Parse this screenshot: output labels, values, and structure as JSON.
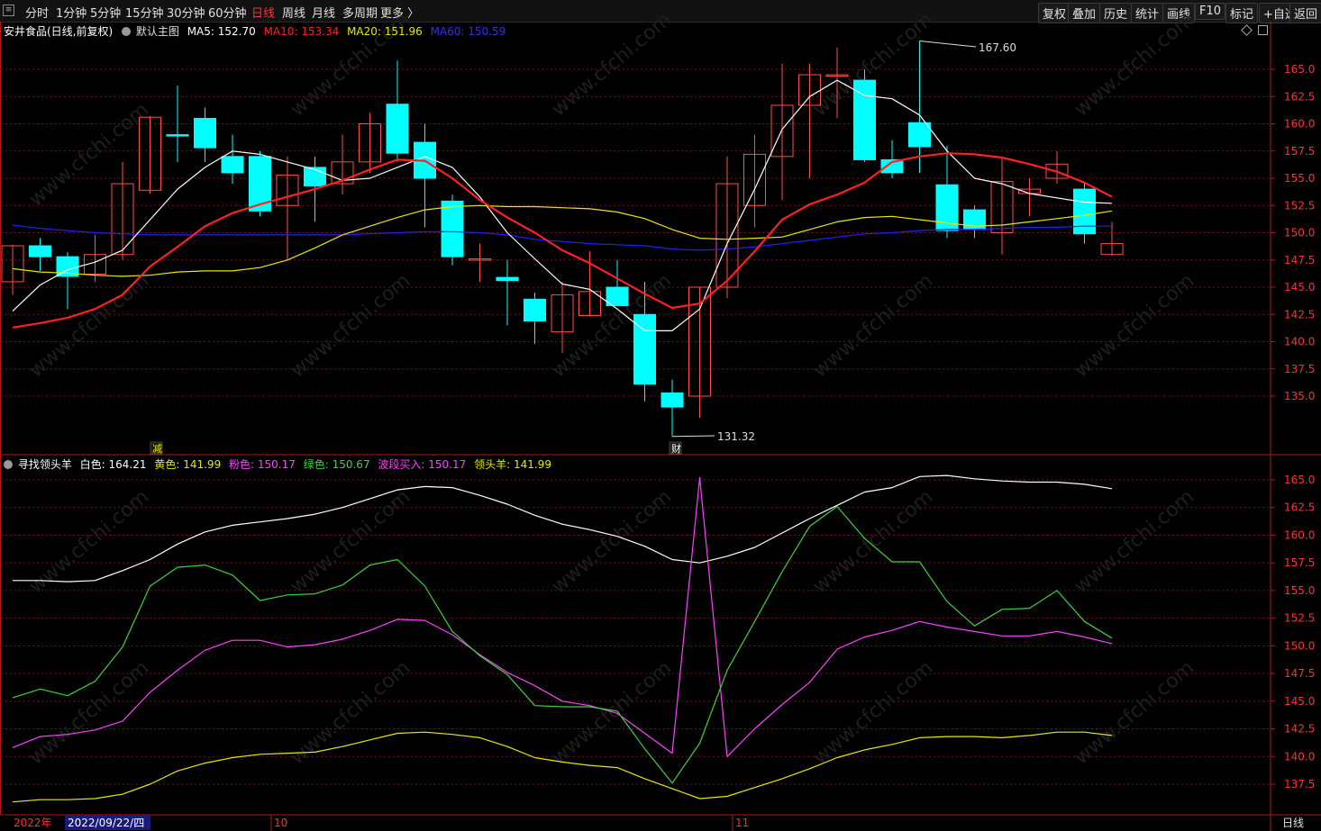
{
  "toolbar": {
    "periods": [
      "分时",
      "1分钟",
      "5分钟",
      "15分钟",
      "30分钟",
      "60分钟",
      "日线",
      "周线",
      "月线",
      "多周期",
      "更多 〉"
    ],
    "active_period": "日线",
    "right_buttons": [
      "复权",
      "叠加",
      "历史",
      "统计",
      "画线",
      "F10",
      "标记",
      "+自选",
      "返回"
    ]
  },
  "main_header": {
    "title": "安井食品(日线,前复权)",
    "template": "默认主图",
    "ma5": "MA5: 152.70",
    "ma10": "MA10: 153.34",
    "ma20": "MA20: 151.96",
    "ma60": "MA60: 150.59"
  },
  "sub_header": {
    "name": "寻找领头羊",
    "white": "白色: 164.21",
    "yellow": "黄色: 141.99",
    "pink": "粉色: 150.17",
    "green": "绿色: 150.67",
    "wave": "波段买入: 150.17",
    "leader": "领头羊: 141.99"
  },
  "annotations": {
    "high_label": "167.60",
    "low_label": "131.32",
    "marker1": "减",
    "marker2": "财"
  },
  "bottom_axis": {
    "year": "2022年",
    "cursor_date": "2022/09/22/四",
    "months": [
      "10",
      "11"
    ],
    "period": "日线"
  },
  "watermark": "www.cfchi.com",
  "colors": {
    "up": "#ff4d4d",
    "down": "#00ffff",
    "ma5": "#ffffff",
    "ma10": "#ff2020",
    "ma20": "#e8e800",
    "ma60": "#2020ff",
    "white": "#ffffff",
    "yellow": "#e8e800",
    "pink": "#ff40ff",
    "green": "#40d040"
  },
  "chart_data": [
    {
      "type": "candlestick",
      "title": "安井食品(日线,前复权)",
      "ylim": [
        131,
        167.6
      ],
      "yticks": [
        135.0,
        137.5,
        140.0,
        142.5,
        145.0,
        147.5,
        150.0,
        152.5,
        155.0,
        157.5,
        160.0,
        162.5,
        165.0
      ],
      "candles": [
        {
          "o": 145.5,
          "h": 148.9,
          "l": 144.3,
          "c": 148.8
        },
        {
          "o": 148.8,
          "h": 149.5,
          "l": 146.5,
          "c": 147.8
        },
        {
          "o": 147.8,
          "h": 148.2,
          "l": 143.0,
          "c": 146.0
        },
        {
          "o": 146.2,
          "h": 149.8,
          "l": 145.5,
          "c": 148.0
        },
        {
          "o": 148.0,
          "h": 156.5,
          "l": 147.5,
          "c": 154.5
        },
        {
          "o": 153.9,
          "h": 160.7,
          "l": 153.6,
          "c": 160.6
        },
        {
          "o": 159.0,
          "h": 163.5,
          "l": 156.5,
          "c": 158.9
        },
        {
          "o": 160.5,
          "h": 161.5,
          "l": 156.5,
          "c": 157.8
        },
        {
          "o": 157.0,
          "h": 159.0,
          "l": 154.5,
          "c": 155.5
        },
        {
          "o": 157.0,
          "h": 157.5,
          "l": 151.5,
          "c": 152.0
        },
        {
          "o": 152.5,
          "h": 157.0,
          "l": 147.5,
          "c": 155.3
        },
        {
          "o": 156.0,
          "h": 157.0,
          "l": 151.0,
          "c": 154.3
        },
        {
          "o": 154.5,
          "h": 159.0,
          "l": 153.5,
          "c": 156.5
        },
        {
          "o": 156.5,
          "h": 161.0,
          "l": 155.5,
          "c": 160.0
        },
        {
          "o": 161.8,
          "h": 165.8,
          "l": 156.5,
          "c": 157.3
        },
        {
          "o": 158.3,
          "h": 160.0,
          "l": 150.5,
          "c": 155.0
        },
        {
          "o": 152.9,
          "h": 153.5,
          "l": 147.0,
          "c": 147.8
        },
        {
          "o": 147.6,
          "h": 149.0,
          "l": 145.5,
          "c": 147.6
        },
        {
          "o": 145.9,
          "h": 147.5,
          "l": 141.5,
          "c": 145.6
        },
        {
          "o": 143.9,
          "h": 144.5,
          "l": 139.8,
          "c": 141.9
        },
        {
          "o": 140.9,
          "h": 145.5,
          "l": 139.0,
          "c": 144.3
        },
        {
          "o": 142.4,
          "h": 148.3,
          "l": 142.3,
          "c": 144.6
        },
        {
          "o": 145.0,
          "h": 147.5,
          "l": 143.5,
          "c": 143.3
        },
        {
          "o": 142.5,
          "h": 145.5,
          "l": 134.5,
          "c": 136.1
        },
        {
          "o": 135.3,
          "h": 136.5,
          "l": 131.3,
          "c": 134.0
        },
        {
          "o": 135.0,
          "h": 145.0,
          "l": 133.0,
          "c": 145.0
        },
        {
          "o": 145.0,
          "h": 157.0,
          "l": 144.0,
          "c": 154.5
        },
        {
          "o": 152.5,
          "h": 159.0,
          "l": 150.5,
          "c": 157.2
        },
        {
          "o": 157.0,
          "h": 165.5,
          "l": 153.0,
          "c": 161.7
        },
        {
          "o": 161.7,
          "h": 165.5,
          "l": 155.0,
          "c": 164.5
        },
        {
          "o": 164.5,
          "h": 167.0,
          "l": 160.5,
          "c": 164.5
        },
        {
          "o": 164.0,
          "h": 165.0,
          "l": 156.5,
          "c": 156.7
        },
        {
          "o": 156.7,
          "h": 158.5,
          "l": 155.0,
          "c": 155.5
        },
        {
          "o": 160.1,
          "h": 167.6,
          "l": 155.5,
          "c": 157.9
        },
        {
          "o": 154.4,
          "h": 158.0,
          "l": 149.5,
          "c": 150.2
        },
        {
          "o": 152.1,
          "h": 152.5,
          "l": 149.5,
          "c": 150.3
        },
        {
          "o": 150.0,
          "h": 157.0,
          "l": 148.0,
          "c": 154.7
        },
        {
          "o": 153.6,
          "h": 155.0,
          "l": 151.5,
          "c": 154.0
        },
        {
          "o": 155.0,
          "h": 157.5,
          "l": 154.5,
          "c": 156.3
        },
        {
          "o": 154.0,
          "h": 154.5,
          "l": 149.0,
          "c": 149.9
        },
        {
          "o": 148.0,
          "h": 151.0,
          "l": 147.9,
          "c": 149.0
        }
      ],
      "ma5": [
        142.8,
        145.2,
        146.6,
        147.3,
        148.4,
        151.2,
        154.0,
        156.0,
        157.5,
        157.2,
        156.5,
        155.8,
        154.8,
        155.0,
        156.0,
        157.0,
        156.0,
        153.3,
        150.0,
        147.6,
        145.3,
        144.8,
        143.0,
        141.0,
        141.0,
        143.0,
        149.0,
        154.0,
        159.5,
        162.5,
        164.0,
        162.6,
        162.3,
        160.8,
        157.5,
        155.0,
        154.5,
        153.6,
        153.2,
        152.8,
        152.7
      ],
      "ma10": [
        141.3,
        141.7,
        142.2,
        143.0,
        144.3,
        146.9,
        148.7,
        150.6,
        151.8,
        152.6,
        153.3,
        154.0,
        154.8,
        155.8,
        156.7,
        156.6,
        155.0,
        153.0,
        151.4,
        150.0,
        148.4,
        147.2,
        145.8,
        144.4,
        143.1,
        143.5,
        145.6,
        148.3,
        151.2,
        152.6,
        153.5,
        154.6,
        156.5,
        157.0,
        157.3,
        157.2,
        156.9,
        156.3,
        155.6,
        154.6,
        153.3
      ],
      "ma20": [
        146.7,
        146.4,
        146.3,
        146.1,
        146.0,
        146.1,
        146.4,
        146.5,
        146.5,
        146.8,
        147.5,
        148.6,
        149.8,
        150.6,
        151.4,
        152.1,
        152.4,
        152.5,
        152.4,
        152.4,
        152.3,
        152.2,
        151.9,
        151.3,
        150.3,
        149.5,
        149.4,
        149.5,
        149.6,
        150.3,
        151.0,
        151.4,
        151.5,
        151.2,
        150.9,
        150.6,
        150.7,
        151.0,
        151.3,
        151.6,
        152.0
      ],
      "ma60": [
        150.7,
        150.4,
        150.2,
        150.0,
        149.9,
        149.8,
        149.8,
        149.8,
        149.8,
        149.8,
        149.8,
        149.8,
        149.8,
        149.9,
        150.0,
        150.1,
        150.1,
        150.0,
        149.8,
        149.4,
        149.2,
        149.0,
        148.9,
        148.8,
        148.5,
        148.4,
        148.5,
        148.7,
        149.0,
        149.3,
        149.6,
        149.9,
        150.0,
        150.2,
        150.3,
        150.3,
        150.4,
        150.5,
        150.5,
        150.6,
        150.6
      ]
    },
    {
      "type": "line",
      "title": "寻找领头羊",
      "ylim": [
        135.8,
        166.7
      ],
      "yticks": [
        137.5,
        140.0,
        142.5,
        145.0,
        147.5,
        150.0,
        152.5,
        155.0,
        157.5,
        160.0,
        162.5,
        165.0
      ],
      "series": [
        {
          "name": "白色",
          "values": [
            155.9,
            155.9,
            155.8,
            155.9,
            156.8,
            157.8,
            159.2,
            160.3,
            160.9,
            161.2,
            161.5,
            161.9,
            162.5,
            163.3,
            164.1,
            164.4,
            164.3,
            163.6,
            162.8,
            161.8,
            161.0,
            160.5,
            159.9,
            159.0,
            157.8,
            157.5,
            158.1,
            158.9,
            160.2,
            161.5,
            162.7,
            163.9,
            164.3,
            165.3,
            165.4,
            165.1,
            164.9,
            164.8,
            164.8,
            164.6,
            164.2
          ]
        },
        {
          "name": "黄色",
          "values": [
            135.9,
            136.1,
            136.1,
            136.2,
            136.6,
            137.5,
            138.7,
            139.4,
            139.9,
            140.2,
            140.3,
            140.4,
            140.9,
            141.5,
            142.1,
            142.2,
            142.0,
            141.7,
            140.9,
            139.9,
            139.5,
            139.2,
            139.0,
            138.0,
            137.1,
            136.2,
            136.4,
            137.2,
            138.0,
            138.9,
            139.9,
            140.6,
            141.1,
            141.7,
            141.8,
            141.8,
            141.7,
            141.9,
            142.2,
            142.2,
            141.9
          ]
        },
        {
          "name": "粉色",
          "values": [
            140.8,
            141.8,
            142.0,
            142.4,
            143.2,
            145.8,
            147.8,
            149.6,
            150.5,
            150.5,
            149.9,
            150.1,
            150.6,
            151.4,
            152.4,
            152.3,
            151.0,
            149.2,
            147.6,
            146.4,
            145.0,
            144.6,
            143.9,
            142.1,
            140.3,
            165.2,
            140.0,
            142.5,
            144.7,
            146.7,
            149.7,
            150.8,
            151.4,
            152.2,
            151.7,
            151.3,
            150.9,
            150.9,
            151.3,
            150.8,
            150.2
          ]
        },
        {
          "name": "绿色",
          "values": [
            145.3,
            146.1,
            145.5,
            146.8,
            149.9,
            155.4,
            157.1,
            157.3,
            156.4,
            154.1,
            154.6,
            154.7,
            155.5,
            157.3,
            157.8,
            155.4,
            151.3,
            149.1,
            147.4,
            144.6,
            144.5,
            144.5,
            144.1,
            140.7,
            137.6,
            141.2,
            147.8,
            152.2,
            156.7,
            160.8,
            162.6,
            159.7,
            157.6,
            157.6,
            154.0,
            151.8,
            153.3,
            153.4,
            155.0,
            152.2,
            150.7
          ]
        }
      ]
    }
  ]
}
